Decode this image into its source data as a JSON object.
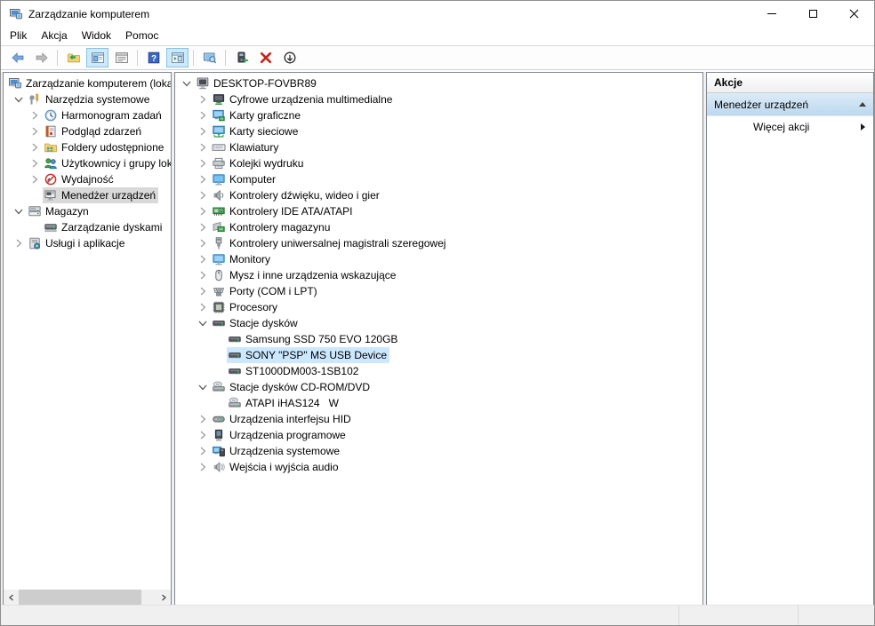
{
  "window": {
    "title": "Zarządzanie komputerem",
    "controls": [
      {
        "name": "minimize"
      },
      {
        "name": "maximize"
      },
      {
        "name": "close"
      }
    ]
  },
  "menu": {
    "items": [
      "Plik",
      "Akcja",
      "Widok",
      "Pomoc"
    ]
  },
  "toolbar": {
    "items": [
      {
        "type": "button",
        "name": "back",
        "icon": "arrow-back",
        "state": "normal"
      },
      {
        "type": "button",
        "name": "forward",
        "icon": "arrow-forward",
        "state": "disabled"
      },
      {
        "type": "separator"
      },
      {
        "type": "button",
        "name": "up-one-level",
        "icon": "folder-up",
        "state": "normal"
      },
      {
        "type": "button",
        "name": "show-console-tree",
        "icon": "pane-left",
        "state": "toggled"
      },
      {
        "type": "button",
        "name": "export-list",
        "icon": "window-list",
        "state": "normal"
      },
      {
        "type": "separator"
      },
      {
        "type": "button",
        "name": "help",
        "icon": "help",
        "state": "normal"
      },
      {
        "type": "button",
        "name": "show-action-pane",
        "icon": "pane-right",
        "state": "toggled"
      },
      {
        "type": "separator"
      },
      {
        "type": "button",
        "name": "scan-hardware-changes",
        "icon": "monitor-search",
        "state": "normal"
      },
      {
        "type": "separator"
      },
      {
        "type": "button",
        "name": "update-driver",
        "icon": "device-arrow",
        "state": "normal"
      },
      {
        "type": "button",
        "name": "uninstall-device",
        "icon": "red-x",
        "state": "normal"
      },
      {
        "type": "button",
        "name": "disable-device",
        "icon": "circle-down",
        "state": "normal"
      }
    ]
  },
  "left_tree": {
    "items": [
      {
        "label": "Zarządzanie komputerem (loka",
        "icon": "computer-mgmt",
        "level": 0,
        "chevron": "none",
        "selected": false
      },
      {
        "label": "Narzędzia systemowe",
        "icon": "system-tools",
        "level": 1,
        "chevron": "expanded",
        "selected": false
      },
      {
        "label": "Harmonogram zadań",
        "icon": "task-scheduler",
        "level": 2,
        "chevron": "collapsed",
        "selected": false
      },
      {
        "label": "Podgląd zdarzeń",
        "icon": "event-viewer",
        "level": 2,
        "chevron": "collapsed",
        "selected": false
      },
      {
        "label": "Foldery udostępnione",
        "icon": "shared-folders",
        "level": 2,
        "chevron": "collapsed",
        "selected": false
      },
      {
        "label": "Użytkownicy i grupy lok",
        "icon": "local-users",
        "level": 2,
        "chevron": "collapsed",
        "selected": false
      },
      {
        "label": "Wydajność",
        "icon": "performance",
        "level": 2,
        "chevron": "collapsed",
        "selected": false
      },
      {
        "label": "Menedżer urządzeń",
        "icon": "device-manager",
        "level": 2,
        "chevron": "none",
        "selected": true
      },
      {
        "label": "Magazyn",
        "icon": "storage",
        "level": 1,
        "chevron": "expanded",
        "selected": false
      },
      {
        "label": "Zarządzanie dyskami",
        "icon": "disk-management",
        "level": 2,
        "chevron": "none",
        "selected": false
      },
      {
        "label": "Usługi i aplikacje",
        "icon": "services-apps",
        "level": 1,
        "chevron": "collapsed",
        "selected": false
      }
    ]
  },
  "device_tree": {
    "items": [
      {
        "label": "DESKTOP-FOVBR89",
        "icon": "computer-root",
        "level": 0,
        "chevron": "expanded",
        "selected": false
      },
      {
        "label": "Cyfrowe urządzenia multimedialne",
        "icon": "media-device",
        "level": 1,
        "chevron": "collapsed",
        "selected": false
      },
      {
        "label": "Karty graficzne",
        "icon": "display-adapter",
        "level": 1,
        "chevron": "collapsed",
        "selected": false
      },
      {
        "label": "Karty sieciowe",
        "icon": "network-adapter",
        "level": 1,
        "chevron": "collapsed",
        "selected": false
      },
      {
        "label": "Klawiatury",
        "icon": "keyboard",
        "level": 1,
        "chevron": "collapsed",
        "selected": false
      },
      {
        "label": "Kolejki wydruku",
        "icon": "printer",
        "level": 1,
        "chevron": "collapsed",
        "selected": false
      },
      {
        "label": "Komputer",
        "icon": "computer",
        "level": 1,
        "chevron": "collapsed",
        "selected": false
      },
      {
        "label": "Kontrolery dźwięku, wideo i gier",
        "icon": "speaker",
        "level": 1,
        "chevron": "collapsed",
        "selected": false
      },
      {
        "label": "Kontrolery IDE ATA/ATAPI",
        "icon": "ide-controller",
        "level": 1,
        "chevron": "collapsed",
        "selected": false
      },
      {
        "label": "Kontrolery magazynu",
        "icon": "storage-controller",
        "level": 1,
        "chevron": "collapsed",
        "selected": false
      },
      {
        "label": "Kontrolery uniwersalnej magistrali szeregowej",
        "icon": "usb-controller",
        "level": 1,
        "chevron": "collapsed",
        "selected": false
      },
      {
        "label": "Monitory",
        "icon": "monitor",
        "level": 1,
        "chevron": "collapsed",
        "selected": false
      },
      {
        "label": "Mysz i inne urządzenia wskazujące",
        "icon": "mouse",
        "level": 1,
        "chevron": "collapsed",
        "selected": false
      },
      {
        "label": "Porty (COM i LPT)",
        "icon": "ports",
        "level": 1,
        "chevron": "collapsed",
        "selected": false
      },
      {
        "label": "Procesory",
        "icon": "processor",
        "level": 1,
        "chevron": "collapsed",
        "selected": false
      },
      {
        "label": "Stacje dysków",
        "icon": "disk-drive",
        "level": 1,
        "chevron": "expanded",
        "selected": false
      },
      {
        "label": "Samsung SSD 750 EVO 120GB",
        "icon": "disk-drive",
        "level": 2,
        "chevron": "none",
        "selected": false
      },
      {
        "label": "SONY \"PSP\" MS USB Device",
        "icon": "disk-drive",
        "level": 2,
        "chevron": "none",
        "selected": true
      },
      {
        "label": "ST1000DM003-1SB102",
        "icon": "disk-drive",
        "level": 2,
        "chevron": "none",
        "selected": false
      },
      {
        "label": "Stacje dysków CD-ROM/DVD",
        "icon": "cd-drive",
        "level": 1,
        "chevron": "expanded",
        "selected": false
      },
      {
        "label": "ATAPI iHAS124   W",
        "icon": "cd-drive",
        "level": 2,
        "chevron": "none",
        "selected": false
      },
      {
        "label": "Urządzenia interfejsu HID",
        "icon": "hid-device",
        "level": 1,
        "chevron": "collapsed",
        "selected": false
      },
      {
        "label": "Urządzenia programowe",
        "icon": "software-device",
        "level": 1,
        "chevron": "collapsed",
        "selected": false
      },
      {
        "label": "Urządzenia systemowe",
        "icon": "system-device",
        "level": 1,
        "chevron": "collapsed",
        "selected": false
      },
      {
        "label": "Wejścia i wyjścia audio",
        "icon": "audio-device",
        "level": 1,
        "chevron": "collapsed",
        "selected": false
      }
    ]
  },
  "actions": {
    "header": "Akcje",
    "section_title": "Menedżer urządzeń",
    "more_label": "Więcej akcji"
  },
  "colors": {
    "selection_active": "#cce8ff",
    "selection_inactive": "#d9d9d9",
    "action_bar_top": "#dcebf8",
    "action_bar_bottom": "#bcd8ee"
  }
}
